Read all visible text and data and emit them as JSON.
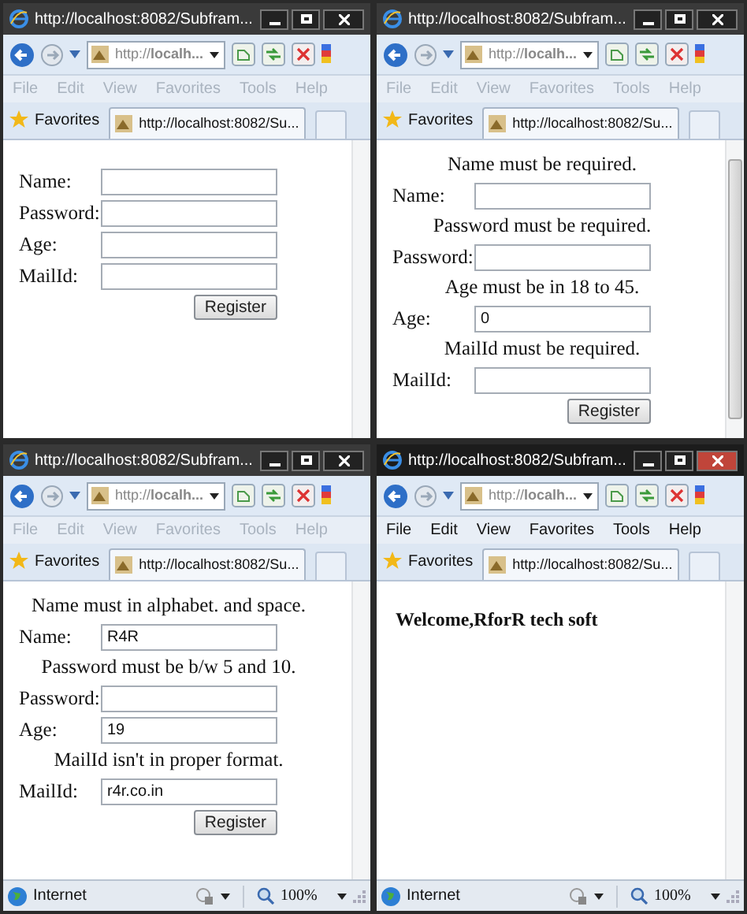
{
  "windows": [
    {
      "title": "http://localhost:8082/Subfram...",
      "active": false,
      "address": "http://**localh...**",
      "menu": [
        "File",
        "Edit",
        "View",
        "Favorites",
        "Tools",
        "Help"
      ],
      "favorites": "Favorites",
      "tab": "http://localhost:8082/Su...",
      "scrollable": false,
      "content": {
        "kind": "form",
        "rows": [
          {
            "label": "Name:"
          },
          {
            "label": "Password:"
          },
          {
            "label": "Age:"
          },
          {
            "label": "MailId:"
          }
        ],
        "button": "Register"
      }
    },
    {
      "title": "http://localhost:8082/Subfram...",
      "active": false,
      "address": "http://**localh...**",
      "menu": [
        "File",
        "Edit",
        "View",
        "Favorites",
        "Tools",
        "Help"
      ],
      "favorites": "Favorites",
      "tab": "http://localhost:8082/Su...",
      "scrollable": true,
      "content": {
        "kind": "form",
        "rows": [
          {
            "error": "Name must be required.",
            "label": "Name:"
          },
          {
            "error": "Password must be required.",
            "label": "Password:"
          },
          {
            "error": "Age must be in 18 to 45.",
            "label": "Age:",
            "value": "0"
          },
          {
            "error": "MailId must be required.",
            "label": "MailId:"
          }
        ],
        "button": "Register"
      }
    },
    {
      "title": "http://localhost:8082/Subfram...",
      "active": false,
      "address": "http://**localh...**",
      "menu": [
        "File",
        "Edit",
        "View",
        "Favorites",
        "Tools",
        "Help"
      ],
      "favorites": "Favorites",
      "tab": "http://localhost:8082/Su...",
      "scrollable": false,
      "content": {
        "kind": "form",
        "rows": [
          {
            "error": "Name must in alphabet. and space.",
            "label": "Name:",
            "value": "R4R"
          },
          {
            "error": "Password must be b/w 5 and 10.",
            "label": "Password:"
          },
          {
            "label": "Age:",
            "value": "19"
          },
          {
            "error": "MailId isn't in proper format.",
            "label": "MailId:",
            "value": "r4r.co.in"
          }
        ],
        "button": "Register"
      },
      "status": {
        "zone": "Internet",
        "zoom": "100%"
      }
    },
    {
      "title": "http://localhost:8082/Subfram...",
      "active": true,
      "address": "http://**localh...**",
      "menu": [
        "File",
        "Edit",
        "View",
        "Favorites",
        "Tools",
        "Help"
      ],
      "favorites": "Favorites",
      "tab": "http://localhost:8082/Su...",
      "scrollable": false,
      "content": {
        "kind": "message",
        "text": "Welcome,RforR tech soft"
      },
      "status": {
        "zone": "Internet",
        "zoom": "100%"
      }
    }
  ]
}
